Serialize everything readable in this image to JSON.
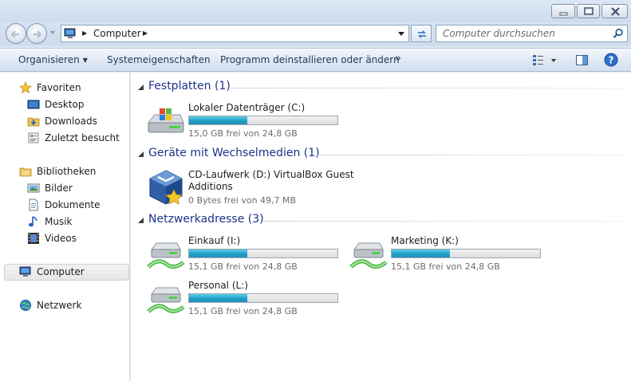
{
  "address": {
    "crumb": "Computer",
    "search_placeholder": "Computer durchsuchen"
  },
  "toolbar": {
    "organize": "Organisieren",
    "system_properties": "Systemeigenschaften",
    "uninstall": "Programm deinstallieren oder ändern",
    "more": "»"
  },
  "nav": {
    "favorites": "Favoriten",
    "desktop": "Desktop",
    "downloads": "Downloads",
    "recent": "Zuletzt besucht",
    "libraries": "Bibliotheken",
    "pictures": "Bilder",
    "documents": "Dokumente",
    "music": "Musik",
    "videos": "Videos",
    "computer": "Computer",
    "network": "Netzwerk"
  },
  "groups": {
    "hard_disks": "Festplatten (1)",
    "removable": "Geräte mit Wechselmedien (1)",
    "network": "Netzwerkadresse (3)"
  },
  "drives": {
    "local_c": {
      "name": "Lokaler Datenträger (C:)",
      "space": "15,0 GB frei von 24,8 GB",
      "used_fraction": 0.395
    },
    "cd_d": {
      "name_line1": "CD-Laufwerk (D:) VirtualBox Guest",
      "name_line2": "Additions",
      "space": "0 Bytes frei von 49,7 MB"
    },
    "einkauf": {
      "name": "Einkauf (I:)",
      "space": "15,1 GB frei von 24,8 GB",
      "used_fraction": 0.39
    },
    "marketing": {
      "name": "Marketing (K:)",
      "space": "15,1 GB frei von 24,8 GB",
      "used_fraction": 0.39
    },
    "personal": {
      "name": "Personal (L:)",
      "space": "15,1 GB frei von 24,8 GB",
      "used_fraction": 0.39
    }
  },
  "colors": {
    "group_title": "#1e3287",
    "bar_fill": "#1e9fc5",
    "toolbar_text": "#1e395b"
  }
}
